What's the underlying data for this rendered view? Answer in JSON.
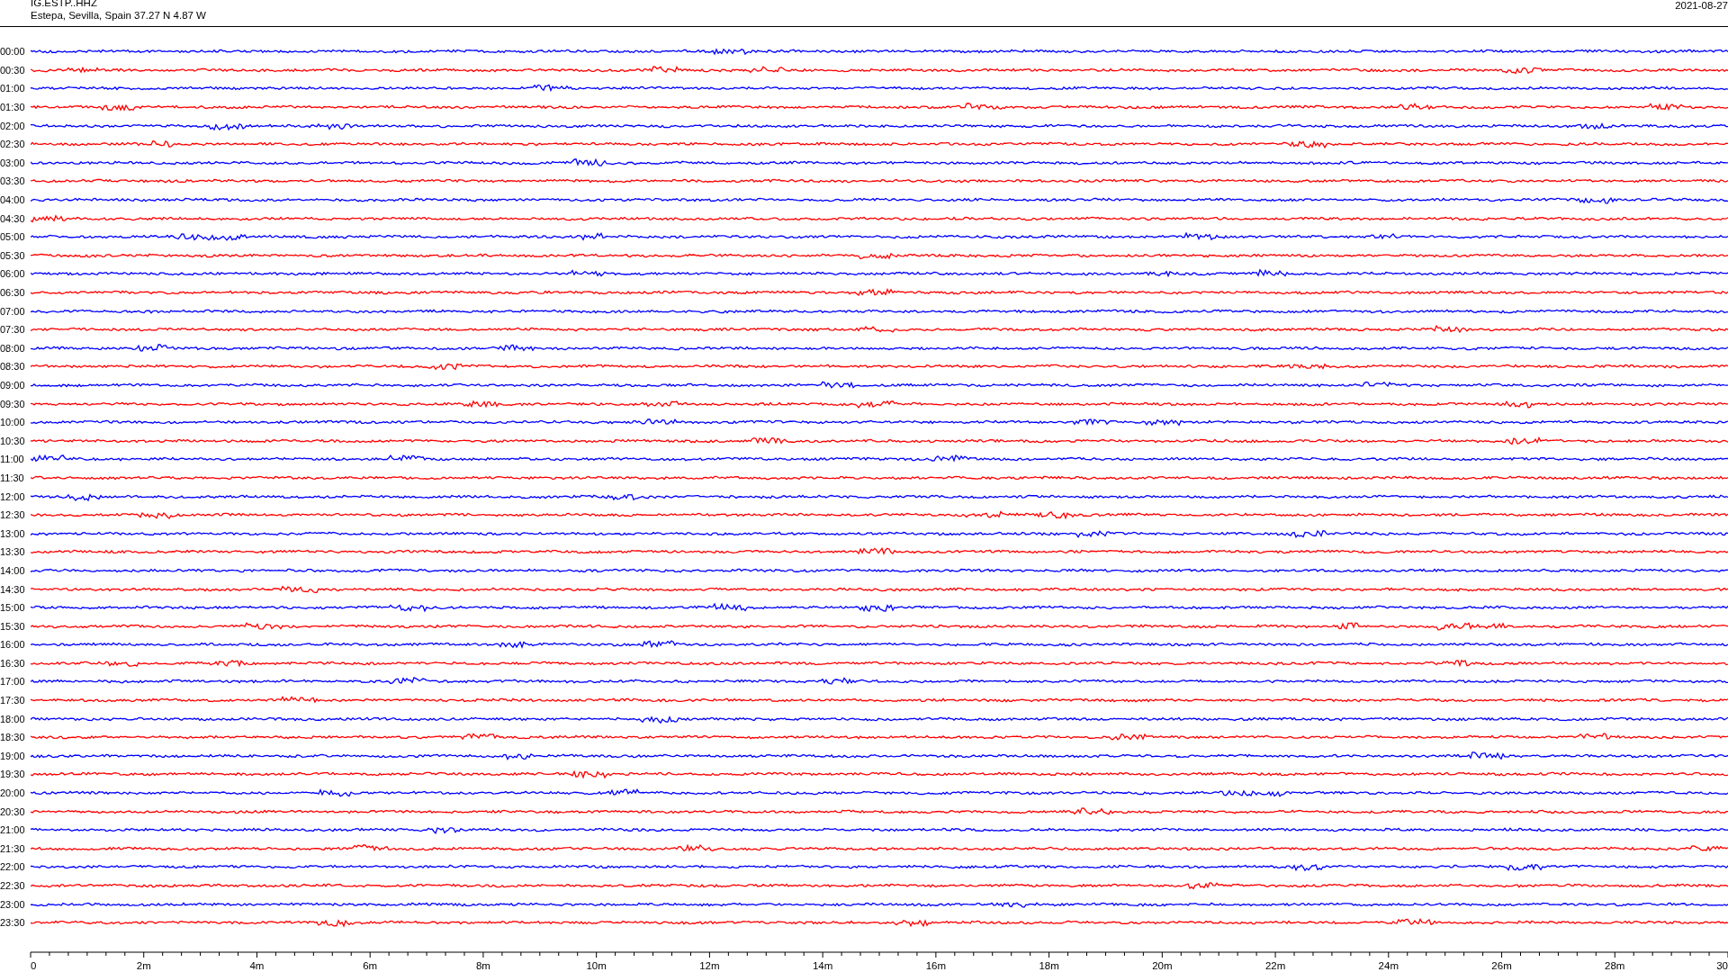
{
  "header": {
    "station": "IG.ESTP..HHZ",
    "location": "Estepa, Sevilla, Spain  37.27 N 4.87 W",
    "date": "2021-08-27"
  },
  "rows": [
    {
      "time": "00:00",
      "color": "#0000ff"
    },
    {
      "time": "00:30",
      "color": "#ff0000"
    },
    {
      "time": "01:00",
      "color": "#0000ff"
    },
    {
      "time": "01:30",
      "color": "#ff0000"
    },
    {
      "time": "02:00",
      "color": "#0000ff"
    },
    {
      "time": "02:30",
      "color": "#ff0000"
    },
    {
      "time": "03:00",
      "color": "#0000ff"
    },
    {
      "time": "03:30",
      "color": "#ff0000"
    },
    {
      "time": "04:00",
      "color": "#0000ff"
    },
    {
      "time": "04:30",
      "color": "#ff0000"
    },
    {
      "time": "05:00",
      "color": "#0000ff"
    },
    {
      "time": "05:30",
      "color": "#ff0000"
    },
    {
      "time": "06:00",
      "color": "#0000ff"
    },
    {
      "time": "06:30",
      "color": "#ff0000"
    },
    {
      "time": "07:00",
      "color": "#0000ff"
    },
    {
      "time": "07:30",
      "color": "#ff0000"
    },
    {
      "time": "08:00",
      "color": "#0000ff"
    },
    {
      "time": "08:30",
      "color": "#ff0000"
    },
    {
      "time": "09:00",
      "color": "#0000ff"
    },
    {
      "time": "09:30",
      "color": "#ff0000"
    },
    {
      "time": "10:00",
      "color": "#0000ff"
    },
    {
      "time": "10:30",
      "color": "#ff0000"
    },
    {
      "time": "11:00",
      "color": "#0000ff"
    },
    {
      "time": "11:30",
      "color": "#ff0000"
    },
    {
      "time": "12:00",
      "color": "#0000ff"
    },
    {
      "time": "12:30",
      "color": "#ff0000"
    },
    {
      "time": "13:00",
      "color": "#0000ff"
    },
    {
      "time": "13:30",
      "color": "#ff0000"
    },
    {
      "time": "14:00",
      "color": "#0000ff"
    },
    {
      "time": "14:30",
      "color": "#ff0000"
    },
    {
      "time": "15:00",
      "color": "#0000ff"
    },
    {
      "time": "15:30",
      "color": "#ff0000"
    },
    {
      "time": "16:00",
      "color": "#0000ff"
    },
    {
      "time": "16:30",
      "color": "#ff0000"
    },
    {
      "time": "17:00",
      "color": "#0000ff"
    },
    {
      "time": "17:30",
      "color": "#ff0000"
    },
    {
      "time": "18:00",
      "color": "#0000ff"
    },
    {
      "time": "18:30",
      "color": "#ff0000"
    },
    {
      "time": "19:00",
      "color": "#0000ff"
    },
    {
      "time": "19:30",
      "color": "#ff0000"
    },
    {
      "time": "20:00",
      "color": "#0000ff"
    },
    {
      "time": "20:30",
      "color": "#ff0000"
    },
    {
      "time": "21:00",
      "color": "#0000ff"
    },
    {
      "time": "21:30",
      "color": "#ff0000"
    },
    {
      "time": "22:00",
      "color": "#0000ff"
    },
    {
      "time": "22:30",
      "color": "#ff0000"
    },
    {
      "time": "23:00",
      "color": "#0000ff"
    },
    {
      "time": "23:30",
      "color": "#ff0000"
    }
  ],
  "axis": {
    "ticks": [
      "0",
      "2m",
      "4m",
      "6m",
      "8m",
      "10m",
      "12m",
      "14m",
      "16m",
      "18m",
      "20m",
      "22m",
      "24m",
      "26m",
      "28m",
      "30"
    ]
  }
}
